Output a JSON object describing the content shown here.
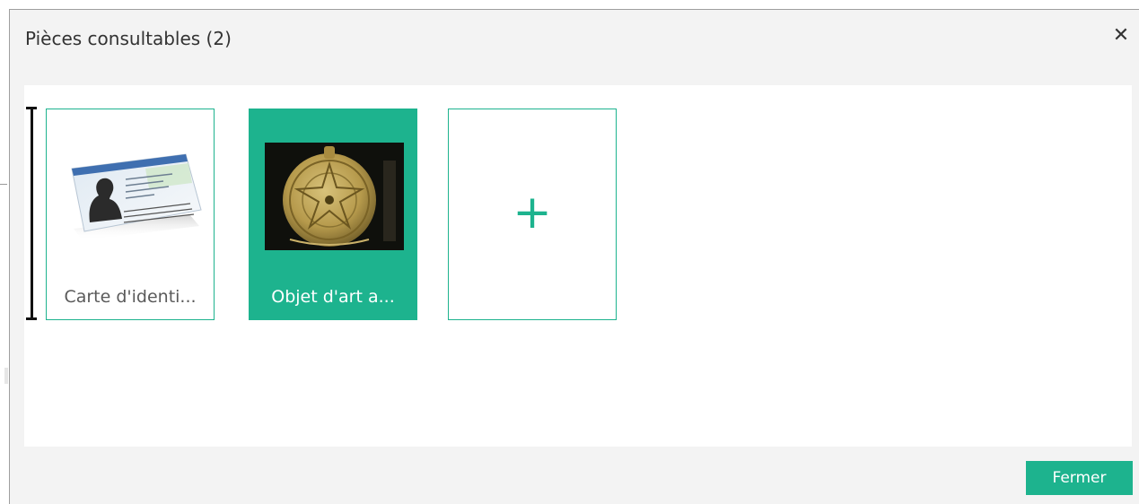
{
  "dialog": {
    "title": "Pièces consultables (2)",
    "close_icon": "close-icon",
    "close_glyph": "✕",
    "footer_button_label": "Fermer"
  },
  "pieces": [
    {
      "label": "Carte d'identi...",
      "thumbnail": "id-card-image",
      "selected": false
    },
    {
      "label": "Objet d'art a...",
      "thumbnail": "astrolabe-image",
      "selected": true
    }
  ],
  "add_card": {
    "icon": "plus-icon",
    "glyph": "+"
  },
  "colors": {
    "accent": "#1db38e",
    "dialog_background": "#f3f3f3",
    "panel_background": "#ffffff",
    "title_text": "#333333",
    "label_text": "#5a5a5a"
  }
}
